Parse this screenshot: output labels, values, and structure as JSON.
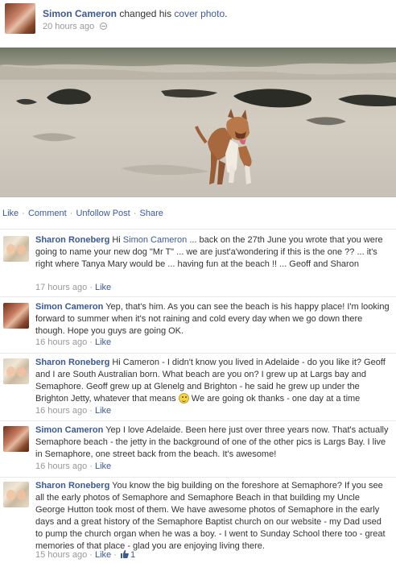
{
  "story": {
    "author": "Simon Cameron",
    "action_text": " changed his ",
    "object_link": "cover photo",
    "object_suffix": ".",
    "time": "20 hours ago"
  },
  "actions": {
    "like": "Like",
    "comment": "Comment",
    "unfollow": "Unfollow Post",
    "share": "Share",
    "separator": "·"
  },
  "comments": [
    {
      "author": "Sharon Roneberg",
      "text_before": " Hi ",
      "mention": "Simon Cameron",
      "text_after": " ... back on the 27th June you wrote that you were going to name your new dog \"Mr T\" ... we are just'a'wondering if this is the one ?? ... it's right where Tanya Mary would be ... having fun at the beach !! ... Geoff and Sharon",
      "time": "17 hours ago",
      "like": "Like"
    },
    {
      "author": "Simon Cameron",
      "text": " Yep, that's him. As you can see the beach is his happy place! I'm looking forward to summer when it's not raining and cold every day when we go down there though. Hope you guys are going OK.",
      "time": "16 hours ago",
      "like": "Like"
    },
    {
      "author": "Sharon Roneberg",
      "text_before": " Hi Cameron - I didn't know you lived in Adelaide - do you like it? Geoff and I are South Australian born. What beach are you on? I grew up at Largs bay and Semaphore. Geoff grew up at Glenelg and Brighton - he said he grew up under the Brighton Jetty, whatever that means ",
      "text_after": " We are going ok thanks - one day at a time",
      "time": "16 hours ago",
      "like": "Like"
    },
    {
      "author": "Simon Cameron",
      "text": " Yep I love Adelaide. Been here just over three years now. That's actually Semaphore beach - the jetty in the background of one of the other pics is Largs Bay. I live in Semaphore, one street back from the beach. It's awesome!",
      "time": "16 hours ago",
      "like": "Like"
    },
    {
      "author": "Sharon Roneberg",
      "text": " You know the big building on the foreshore at Semaphore? If you see all the early photos of Semaphore and Semaphore Beach in that building my Uncle George Hutton took most of them. We have awesome photos of Semaphore in the early days and a great history of the Semaphore Baptist church on our website - my Dad used to pump the church organ when he was a boy. - I went to Sunday School there too - great memories of that place - glad you are enjoying living there.",
      "time": "15 hours ago",
      "like": "Like",
      "like_count": "1"
    }
  ],
  "meta_separator": " · ",
  "icons": {
    "privacy": "globe-icon",
    "emoticon": "smiley-icon",
    "likes": "thumbs-up-icon"
  },
  "colors": {
    "link": "#3b5998",
    "muted": "#999999",
    "text": "#333333"
  }
}
